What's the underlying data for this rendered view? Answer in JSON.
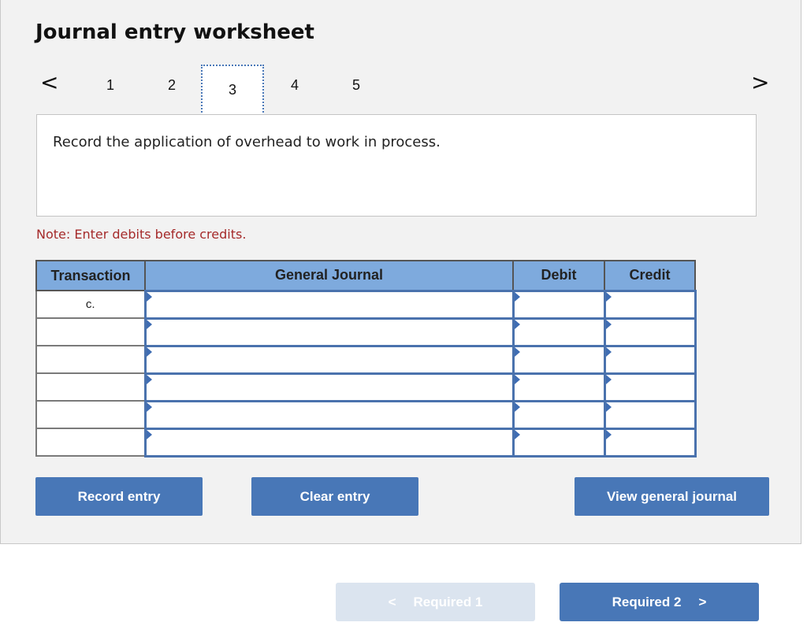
{
  "header": {
    "title": "Journal entry worksheet"
  },
  "steps": {
    "prev_icon": "chevron-left-icon",
    "next_icon": "chevron-right-icon",
    "prev_glyph": "<",
    "next_glyph": ">",
    "items": [
      "1",
      "2",
      "3",
      "4",
      "5"
    ],
    "active": "3"
  },
  "instruction": "Record the application of overhead to work in process.",
  "note": "Note: Enter debits before credits.",
  "table": {
    "headers": [
      "Transaction",
      "General Journal",
      "Debit",
      "Credit"
    ],
    "rows": [
      {
        "transaction": "c.",
        "account": "",
        "debit": "",
        "credit": ""
      },
      {
        "transaction": "",
        "account": "",
        "debit": "",
        "credit": ""
      },
      {
        "transaction": "",
        "account": "",
        "debit": "",
        "credit": ""
      },
      {
        "transaction": "",
        "account": "",
        "debit": "",
        "credit": ""
      },
      {
        "transaction": "",
        "account": "",
        "debit": "",
        "credit": ""
      },
      {
        "transaction": "",
        "account": "",
        "debit": "",
        "credit": ""
      }
    ]
  },
  "buttons": {
    "record": "Record entry",
    "clear": "Clear entry",
    "view": "View general journal"
  },
  "footer": {
    "prev_label": "Required 1",
    "next_label": "Required 2",
    "prev_glyph": "<",
    "next_glyph": ">"
  },
  "colors": {
    "accent": "#4877b7",
    "header_fill": "#7eaadd",
    "note": "#a52a2a",
    "disabled": "#dbe4ef"
  }
}
